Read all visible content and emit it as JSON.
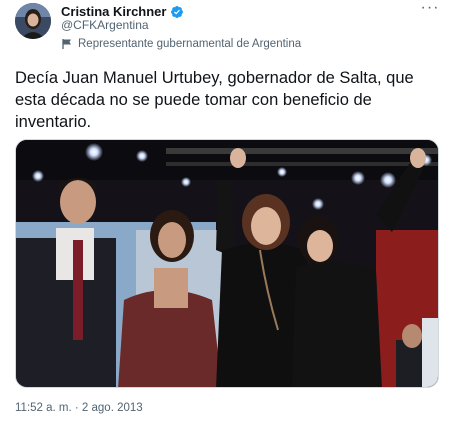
{
  "author": {
    "display_name": "Cristina Kirchner",
    "handle": "@CFKArgentina",
    "label": "Representante gubernamental de Argentina",
    "verified_color": "#1d9bf0"
  },
  "more_icon": "···",
  "tweet": {
    "text": "Decía Juan Manuel Urtubey, gobernador de Salta, que esta década no se puede tomar con beneficio de inventario."
  },
  "meta": {
    "time": "11:52 a. m.",
    "separator": " · ",
    "date": "2 ago. 2013"
  }
}
